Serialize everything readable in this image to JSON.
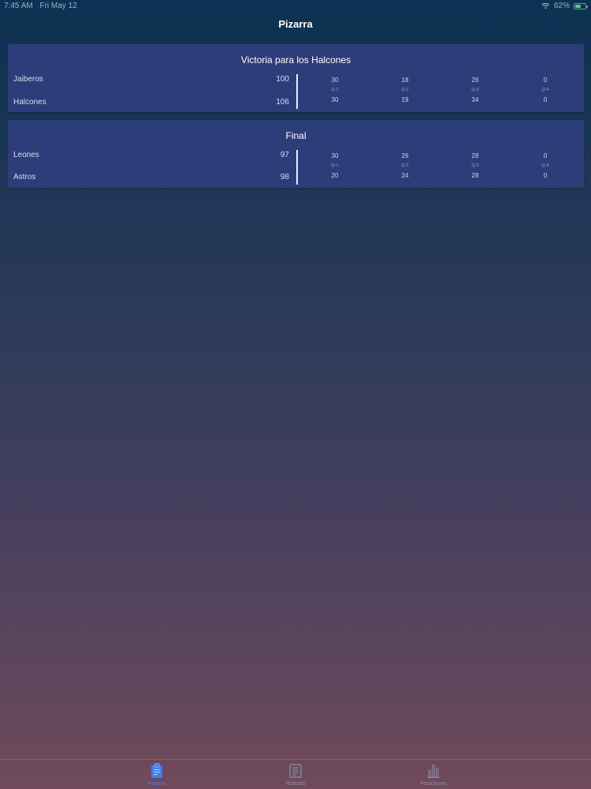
{
  "status_bar": {
    "time": "7:45 AM",
    "date": "Fri May 12",
    "battery": "62%",
    "battery_level": 0.62
  },
  "nav": {
    "title": "Pizarra"
  },
  "games": [
    {
      "title": "Victoria para los Halcones",
      "teams": [
        {
          "name": "Jaiberos",
          "score": "100",
          "quarters": [
            "30",
            "18",
            "26",
            "0"
          ]
        },
        {
          "name": "Halcones",
          "score": "106",
          "quarters": [
            "30",
            "19",
            "34",
            "0"
          ]
        }
      ],
      "quarter_labels": [
        "Q-1",
        "Q-2",
        "Q-3",
        "Q-4"
      ]
    },
    {
      "title": "Final",
      "teams": [
        {
          "name": "Leones",
          "score": "97",
          "quarters": [
            "30",
            "26",
            "28",
            "0"
          ]
        },
        {
          "name": "Astros",
          "score": "98",
          "quarters": [
            "20",
            "24",
            "28",
            "0"
          ]
        }
      ],
      "quarter_labels": [
        "Q-1",
        "Q-2",
        "Q-3",
        "Q-4"
      ]
    }
  ],
  "tabs": [
    {
      "label": "Pizarra",
      "icon": "clipboard-icon",
      "active": true
    },
    {
      "label": "Noticias",
      "icon": "newspaper-icon",
      "active": false
    },
    {
      "label": "Posiciones",
      "icon": "bar-chart-icon",
      "active": false
    }
  ],
  "colors": {
    "accent": "#3d7ff5",
    "card": "#2d3d79",
    "battery": "#4cd964"
  }
}
